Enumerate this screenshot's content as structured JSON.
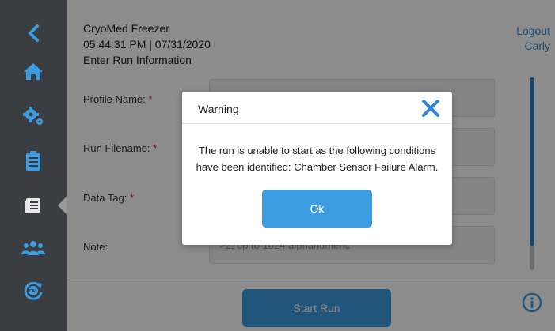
{
  "header": {
    "app_title": "CryoMed Freezer",
    "datetime": "05:44:31 PM | 07/31/2020",
    "screen_title": "Enter Run Information"
  },
  "user": {
    "logout_label": "Logout",
    "username": "Carly"
  },
  "sidebar": {
    "items": [
      {
        "icon": "chevron-left-icon"
      },
      {
        "icon": "home-icon"
      },
      {
        "icon": "gears-icon"
      },
      {
        "icon": "clipboard-icon"
      },
      {
        "icon": "run-list-icon",
        "active": true
      },
      {
        "icon": "users-icon"
      },
      {
        "icon": "calibration-icon"
      }
    ]
  },
  "form": {
    "fields": [
      {
        "label": "Profile Name:",
        "required_mark": "*",
        "placeholder": ""
      },
      {
        "label": "Run Filename:",
        "required_mark": "*",
        "placeholder": ""
      },
      {
        "label": "Data Tag:",
        "required_mark": "*",
        "placeholder": ""
      },
      {
        "label": "Note:",
        "required_mark": "",
        "placeholder": ">2, up to 1024 alphanumeric"
      }
    ],
    "start_label": "Start Run"
  },
  "dialog": {
    "title": "Warning",
    "message_line1": "The run is unable to start as the following conditions",
    "message_line2": "have been identified: Chamber Sensor Failure Alarm.",
    "ok_label": "Ok"
  },
  "colors": {
    "accent": "#3d9be0",
    "sidebar_bg": "#3a3d42",
    "required": "#dd2222"
  }
}
